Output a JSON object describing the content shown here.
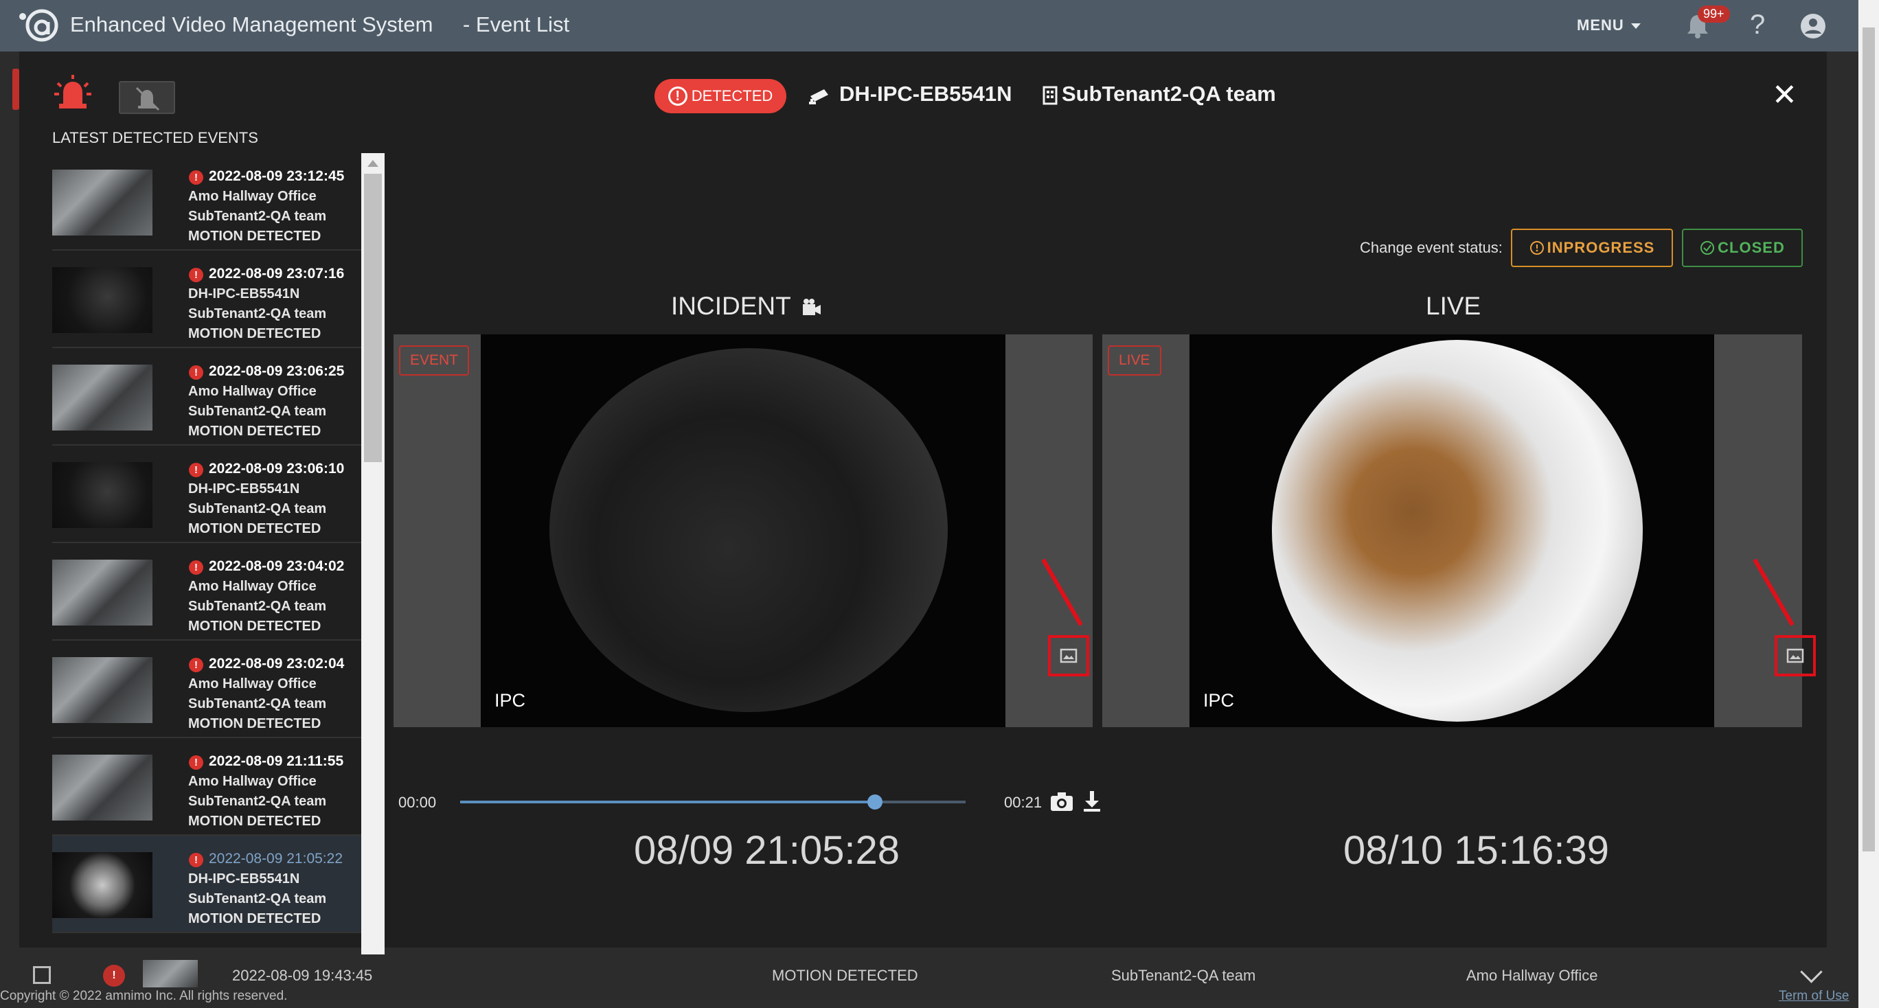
{
  "app": {
    "title": "Enhanced Video Management System",
    "page_title": "- Event List",
    "menu_label": "MENU",
    "notification_count": "99+",
    "help_glyph": "?"
  },
  "modal": {
    "latest_title": "LATEST DETECTED EVENTS",
    "status_chip": "DETECTED",
    "camera_name": "DH-IPC-EB5541N",
    "tenant_name": "SubTenant2-QA team",
    "close_glyph": "✕",
    "change_status_label": "Change event status:",
    "inprogress_label": "INPROGRESS",
    "closed_label": "CLOSED",
    "incident_title": "INCIDENT",
    "live_title": "LIVE",
    "event_tag": "EVENT",
    "live_tag": "LIVE",
    "video_label_left": "IPC",
    "video_label_right": "IPC",
    "timeline": {
      "start": "00:00",
      "end": "00:21",
      "position": 0.82
    },
    "incident_time": "08/09 21:05:28",
    "live_time": "08/10 15:16:39"
  },
  "events": [
    {
      "time": "2022-08-09 23:12:45",
      "location": "Amo Hallway Office",
      "tenant": "SubTenant2-QA team",
      "type": "MOTION DETECTED",
      "thumb": "hall"
    },
    {
      "time": "2022-08-09 23:07:16",
      "location": "DH-IPC-EB5541N",
      "tenant": "SubTenant2-QA team",
      "type": "MOTION DETECTED",
      "thumb": "dark"
    },
    {
      "time": "2022-08-09 23:06:25",
      "location": "Amo Hallway Office",
      "tenant": "SubTenant2-QA team",
      "type": "MOTION DETECTED",
      "thumb": "hall"
    },
    {
      "time": "2022-08-09 23:06:10",
      "location": "DH-IPC-EB5541N",
      "tenant": "SubTenant2-QA team",
      "type": "MOTION DETECTED",
      "thumb": "dark"
    },
    {
      "time": "2022-08-09 23:04:02",
      "location": "Amo Hallway Office",
      "tenant": "SubTenant2-QA team",
      "type": "MOTION DETECTED",
      "thumb": "hall"
    },
    {
      "time": "2022-08-09 23:02:04",
      "location": "Amo Hallway Office",
      "tenant": "SubTenant2-QA team",
      "type": "MOTION DETECTED",
      "thumb": "hall"
    },
    {
      "time": "2022-08-09 21:11:55",
      "location": "Amo Hallway Office",
      "tenant": "SubTenant2-QA team",
      "type": "MOTION DETECTED",
      "thumb": "hall"
    },
    {
      "time": "2022-08-09 21:05:22",
      "location": "DH-IPC-EB5541N",
      "tenant": "SubTenant2-QA team",
      "type": "MOTION DETECTED",
      "thumb": "fish",
      "active": true
    }
  ],
  "table_row": {
    "time": "2022-08-09 19:43:45",
    "type": "MOTION DETECTED",
    "tenant": "SubTenant2-QA team",
    "location": "Amo Hallway Office"
  },
  "footer": {
    "copyright": "Copyright © 2022 amnimo Inc. All rights reserved.",
    "terms": "Term of Use"
  },
  "colors": {
    "topbar": "#4e5b67",
    "detected": "#e8403a",
    "inprogress": "#d98f27",
    "closed": "#3e8e45",
    "highlight": "#e0101a"
  }
}
